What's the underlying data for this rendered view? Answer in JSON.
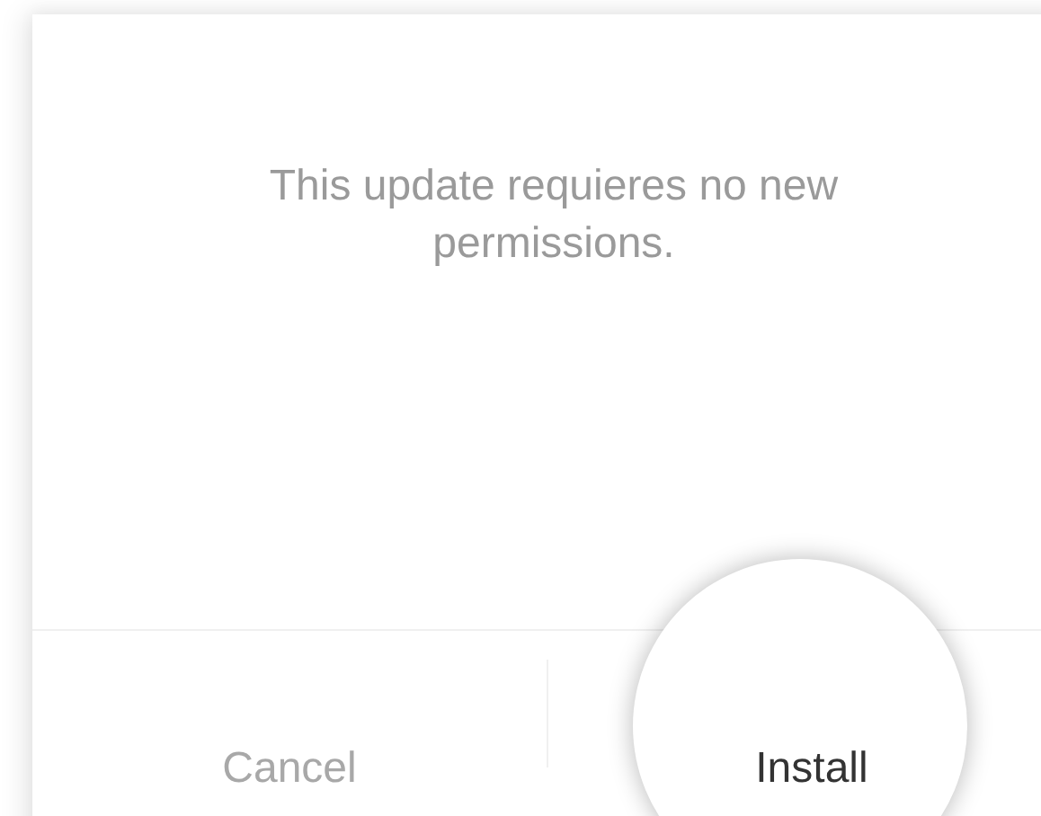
{
  "dialog": {
    "message": "This update requieres no new permissions.",
    "buttons": [
      {
        "label": "Cancel",
        "kind": "cancel",
        "pressed": false
      },
      {
        "label": "Install",
        "kind": "confirm",
        "pressed": true
      }
    ]
  }
}
